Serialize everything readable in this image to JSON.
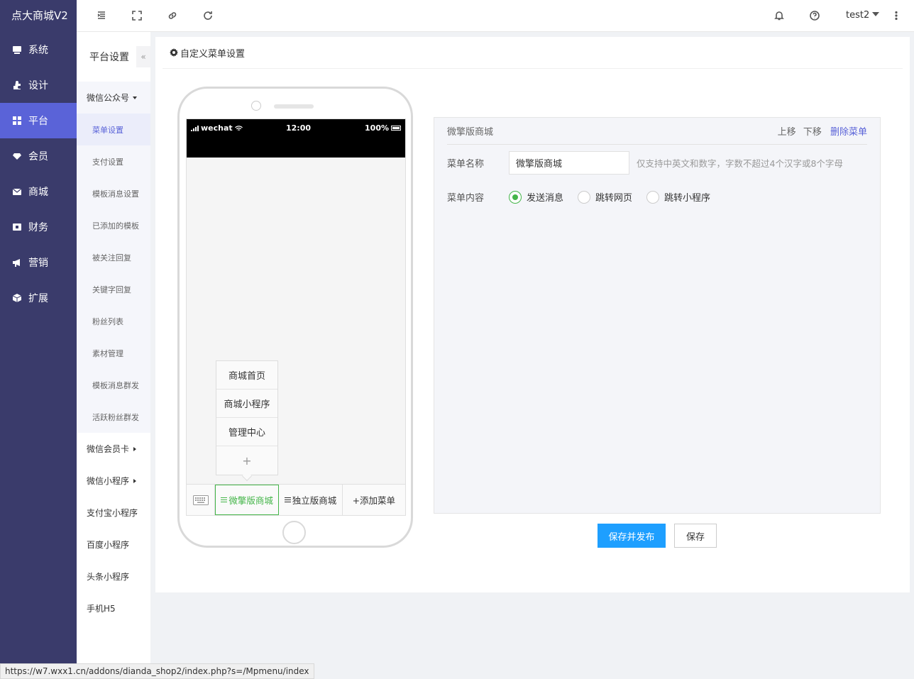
{
  "app": {
    "title": "点大商城V2"
  },
  "sidebar": {
    "items": [
      {
        "label": "系统",
        "icon": "monitor-icon"
      },
      {
        "label": "设计",
        "icon": "puzzle-icon"
      },
      {
        "label": "平台",
        "icon": "grid-icon",
        "active": true
      },
      {
        "label": "会员",
        "icon": "diamond-icon"
      },
      {
        "label": "商城",
        "icon": "mail-icon"
      },
      {
        "label": "财务",
        "icon": "wallet-icon"
      },
      {
        "label": "营销",
        "icon": "megaphone-icon"
      },
      {
        "label": "扩展",
        "icon": "cube-icon"
      }
    ]
  },
  "topbar": {
    "icons": [
      "indent-icon",
      "fullscreen-icon",
      "link-icon",
      "refresh-icon",
      "bell-icon",
      "help-icon",
      "more-icon"
    ],
    "user": "test2"
  },
  "subnav": {
    "title": "平台设置",
    "collapse": "«",
    "wechat_group": "微信公众号",
    "wechat_items": [
      "菜单设置",
      "支付设置",
      "模板消息设置",
      "已添加的模板",
      "被关注回复",
      "关键字回复",
      "粉丝列表",
      "素材管理",
      "模板消息群发",
      "活跃粉丝群发"
    ],
    "groups_after": [
      "微信会员卡",
      "微信小程序"
    ],
    "plain_items": [
      "支付宝小程序",
      "百度小程序",
      "头条小程序",
      "手机H5"
    ]
  },
  "main": {
    "title": "自定义菜单设置"
  },
  "phone": {
    "carrier": "wechat",
    "time": "12:00",
    "battery": "100%",
    "submenu": [
      "商城首页",
      "商城小程序",
      "管理中心"
    ],
    "submenu_add": "+",
    "menus": [
      "微擎版商城",
      "独立版商城"
    ],
    "add_menu": "+添加菜单"
  },
  "editor": {
    "header_name": "微擎版商城",
    "move_up": "上移",
    "move_down": "下移",
    "delete": "删除菜单",
    "name_label": "菜单名称",
    "name_value": "微擎版商城",
    "name_hint": "仅支持中英文和数字，字数不超过4个汉字或8个字母",
    "content_label": "菜单内容",
    "options": [
      "发送消息",
      "跳转网页",
      "跳转小程序"
    ],
    "selected": "发送消息"
  },
  "buttons": {
    "publish": "保存并发布",
    "save": "保存"
  },
  "browser_status": "https://w7.wxx1.cn/addons/dianda_shop2/index.php?s=/Mpmenu/index",
  "colors": {
    "sidebar": "#3a3b6b",
    "active": "#5a63d8",
    "green": "#44b549",
    "primary": "#1e9fff"
  }
}
